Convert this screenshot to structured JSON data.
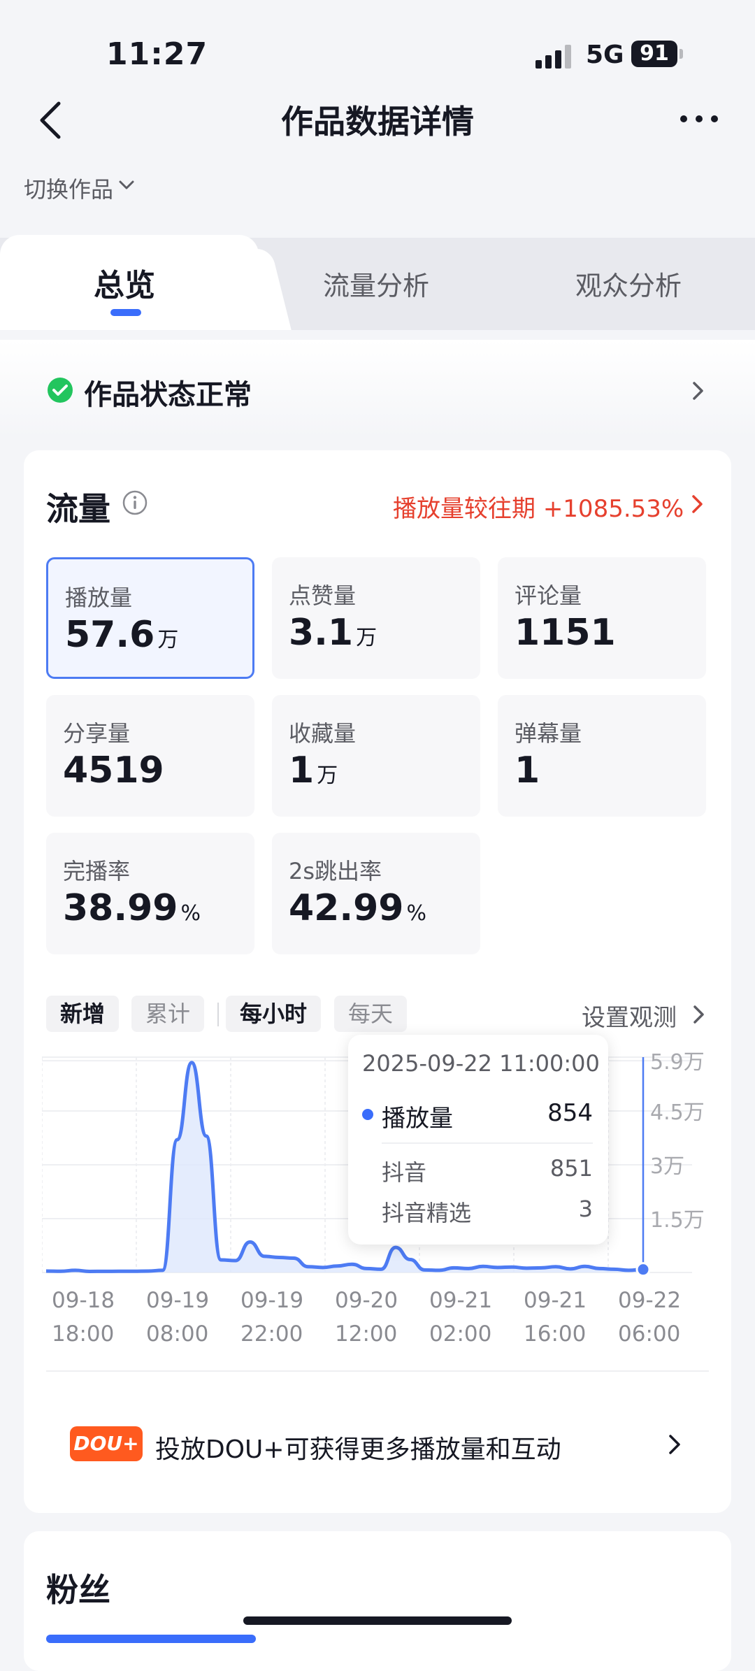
{
  "status_bar": {
    "time": "11:27",
    "network": "5G",
    "battery": "91"
  },
  "nav": {
    "title": "作品数据详情",
    "switch_label": "切换作品"
  },
  "tabs": [
    {
      "label": "总览",
      "active": true
    },
    {
      "label": "流量分析",
      "active": false
    },
    {
      "label": "观众分析",
      "active": false
    }
  ],
  "work_status": {
    "label": "作品状态正常"
  },
  "traffic": {
    "title": "流量",
    "comparison_label": "播放量较往期",
    "comparison_value": "+1085.53%",
    "metrics": [
      {
        "label": "播放量",
        "value": "57.6",
        "unit": "万",
        "selected": true
      },
      {
        "label": "点赞量",
        "value": "3.1",
        "unit": "万"
      },
      {
        "label": "评论量",
        "value": "1151",
        "unit": ""
      },
      {
        "label": "分享量",
        "value": "4519",
        "unit": ""
      },
      {
        "label": "收藏量",
        "value": "1",
        "unit": "万"
      },
      {
        "label": "弹幕量",
        "value": "1",
        "unit": ""
      },
      {
        "label": "完播率",
        "value": "38.99",
        "unit": "%"
      },
      {
        "label": "2s跳出率",
        "value": "42.99",
        "unit": "%"
      }
    ]
  },
  "chart_controls": {
    "mode_new": "新增",
    "mode_cumulative": "累计",
    "period_hourly": "每小时",
    "period_daily": "每天",
    "set_observation": "设置观测"
  },
  "tooltip": {
    "datetime": "2025-09-22 11:00:00",
    "series_label": "播放量",
    "series_value": "854",
    "breakdown": [
      {
        "label": "抖音",
        "value": "851"
      },
      {
        "label": "抖音精选",
        "value": "3"
      }
    ]
  },
  "chart_data": {
    "type": "line",
    "series": [
      {
        "values": [
          400,
          350,
          600,
          300,
          320,
          330,
          350,
          400,
          600,
          37000,
          58500,
          38000,
          3500,
          3300,
          8500,
          4500,
          4200,
          4000,
          1600,
          1400,
          1800,
          2300,
          1100,
          900,
          7000,
          3600,
          700,
          600,
          1300,
          1100,
          1700,
          1400,
          1500,
          1200,
          1300,
          1600,
          1000,
          1700,
          1100,
          900,
          600,
          850
        ]
      }
    ],
    "x_tick_labels": [
      [
        "09-18",
        "18:00"
      ],
      [
        "09-19",
        "08:00"
      ],
      [
        "09-19",
        "22:00"
      ],
      [
        "09-20",
        "12:00"
      ],
      [
        "09-21",
        "02:00"
      ],
      [
        "09-21",
        "16:00"
      ],
      [
        "09-22",
        "06:00"
      ]
    ],
    "y_tick_labels": [
      "5.9万",
      "4.5万",
      "3万",
      "1.5万"
    ],
    "y_tick_values": [
      59000,
      45000,
      30000,
      15000
    ],
    "ylim": [
      0,
      60000
    ],
    "colors": {
      "line": "#4d7bf3",
      "fill": "#dde7fd"
    }
  },
  "promo": {
    "badge": "DOU+",
    "text": "投放DOU+可获得更多播放量和互动"
  },
  "fans": {
    "title": "粉丝"
  },
  "icons": [
    "back-arrow-icon",
    "more-dots-icon",
    "chevron-down-icon",
    "check-circle-icon",
    "chevron-right-icon",
    "info-icon",
    "signal-icon"
  ],
  "colors": {
    "accent": "#3a6dfb",
    "positive_change": "#e6402e",
    "status_ok": "#22c55e",
    "promo": "#ff5a1f"
  }
}
